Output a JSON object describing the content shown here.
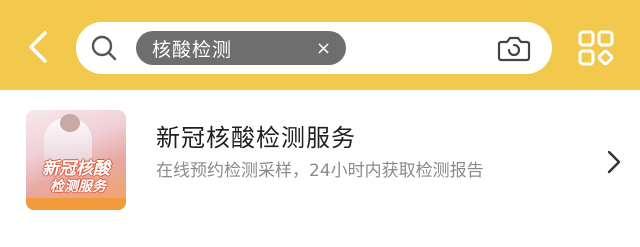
{
  "colors": {
    "header_bg": "#f2c94c",
    "chip_bg": "#6e6e6e",
    "title_text": "#1f1f1f",
    "subtitle_text": "#8a8a8a"
  },
  "header": {
    "back_icon": "chevron-left-icon",
    "search_icon": "search-icon",
    "search_chip": {
      "label": "核酸检测",
      "close_label": "×"
    },
    "camera_icon": "camera-icon",
    "menu_icon": "grid-menu-icon"
  },
  "result": {
    "thumbnail": {
      "line1": "新冠核酸",
      "line2": "检测服务"
    },
    "title": "新冠核酸检测服务",
    "subtitle": "在线预约检测采样，24小时内获取检测报告",
    "chevron_icon": "chevron-right-icon"
  }
}
